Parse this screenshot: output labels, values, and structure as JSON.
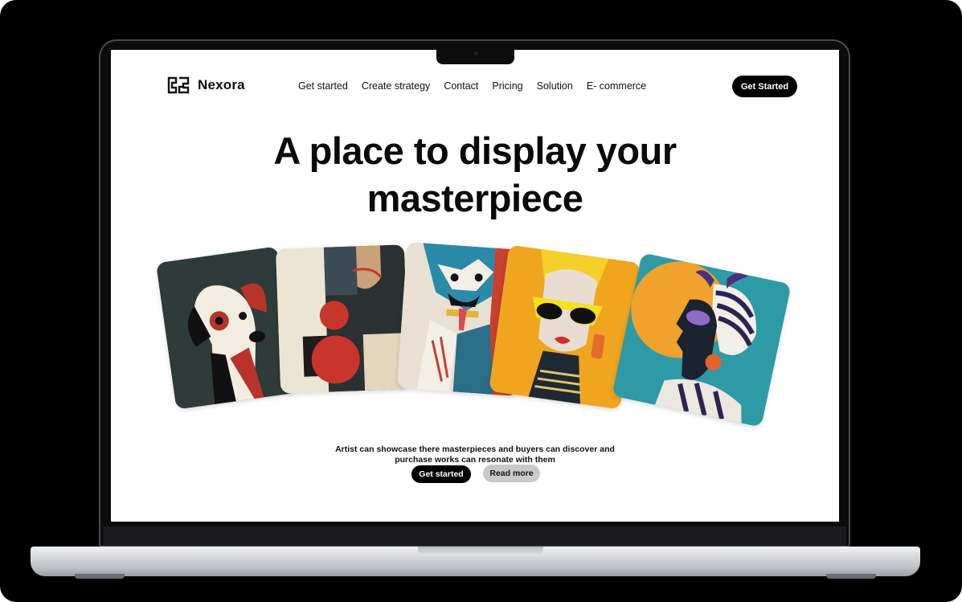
{
  "brand": {
    "name": "Nexora",
    "logo_icon": "maze-logo-icon"
  },
  "nav": {
    "items": [
      "Get started",
      "Create strategy",
      "Contact",
      "Pricing",
      "Solution",
      "E- commerce"
    ],
    "cta_label": "Get Started"
  },
  "hero": {
    "title_line1": "A place to display your",
    "title_line2": "masterpiece",
    "description": "Artist can showcase there masterpieces and buyers can discover and purchase works can resonate with them",
    "primary_button": "Get started",
    "secondary_button": "Read more"
  },
  "gallery": {
    "artworks": [
      "abstract-dog-portrait",
      "abstract-geometric-figure",
      "cubist-dog",
      "woman-yellow-sunglasses",
      "woman-headwrap-profile"
    ]
  },
  "colors": {
    "accent": "#000000",
    "secondary_button": "#c9c9c9",
    "frame": "#000000"
  }
}
